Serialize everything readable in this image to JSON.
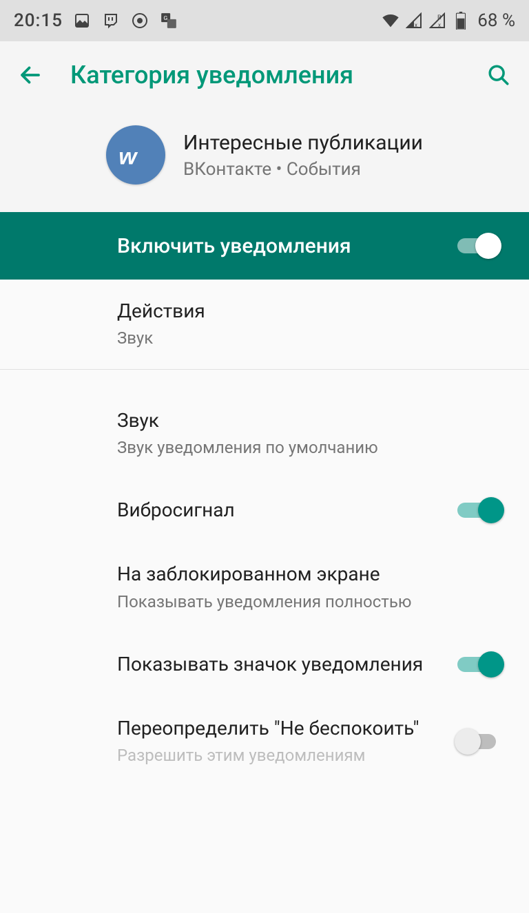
{
  "status": {
    "time": "20:15",
    "battery_text": "68 %"
  },
  "appbar": {
    "title": "Категория уведомления"
  },
  "app_info": {
    "title": "Интересные публикации",
    "subtitle": "ВКонтакте • События",
    "icon_label": "VK"
  },
  "master": {
    "label": "Включить уведомления",
    "on": true
  },
  "items": [
    {
      "title": "Действия",
      "subtitle": "Звук",
      "has_switch": false
    },
    {
      "title": "Звук",
      "subtitle": "Звук уведомления по умолчанию",
      "has_switch": false
    },
    {
      "title": "Вибросигнал",
      "subtitle": "",
      "has_switch": true,
      "on": true
    },
    {
      "title": "На заблокированном экране",
      "subtitle": "Показывать уведомления полностью",
      "has_switch": false
    },
    {
      "title": "Показывать значок уведомления",
      "subtitle": "",
      "has_switch": true,
      "on": true
    },
    {
      "title": "Переопределить \"Не беспокоить\"",
      "subtitle": "Разрешить этим уведомлениям",
      "has_switch": true,
      "on": false
    }
  ]
}
